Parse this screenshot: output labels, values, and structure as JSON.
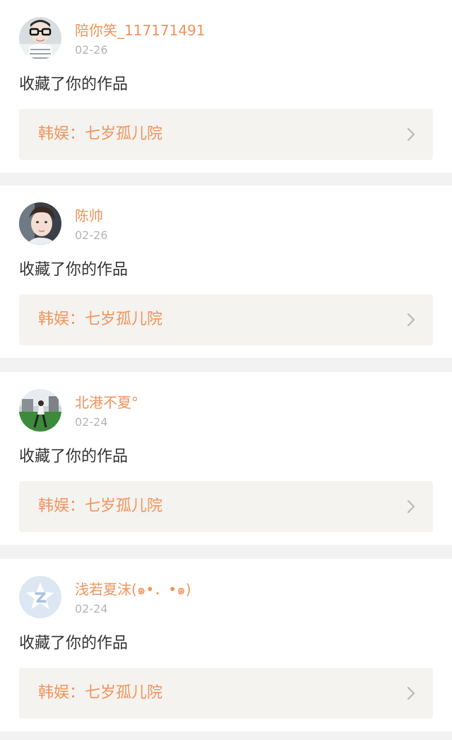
{
  "notifications": [
    {
      "username": "陪你笑_117171491",
      "date": "02-26",
      "action": "收藏了你的作品",
      "work_title": "韩娱：七岁孤儿院"
    },
    {
      "username": "陈帅",
      "date": "02-26",
      "action": "收藏了你的作品",
      "work_title": "韩娱：七岁孤儿院"
    },
    {
      "username": "北港不夏°",
      "date": "02-24",
      "action": "收藏了你的作品",
      "work_title": "韩娱：七岁孤儿院"
    },
    {
      "username": "浅若夏沫(๑•．•๑)",
      "date": "02-24",
      "action": "收藏了你的作品",
      "work_title": "韩娱：七岁孤儿院"
    }
  ],
  "colors": {
    "accent": "#f0935c",
    "muted": "#b5b5b5",
    "text": "#333333",
    "link_bg": "#f4f3ef",
    "page_bg": "#f2f2f2"
  },
  "icons": [
    "user-avatar",
    "user-avatar",
    "user-avatar",
    "default-qq-avatar-icon",
    "chevron-right-icon"
  ]
}
